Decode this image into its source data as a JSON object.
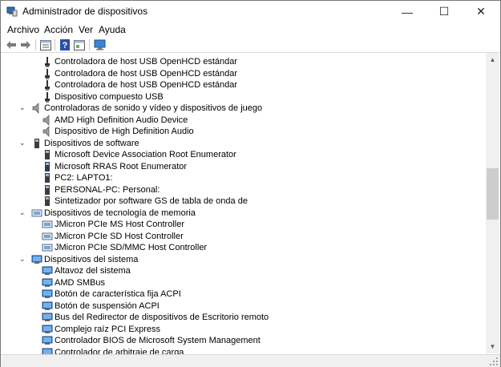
{
  "window": {
    "title": "Administrador de dispositivos",
    "minimize_glyph": "—",
    "maximize_glyph": "☐",
    "close_glyph": "✕"
  },
  "menu": [
    "Archivo",
    "Acción",
    "Ver",
    "Ayuda"
  ],
  "toolbar": {
    "icons": [
      "back-arrow-icon",
      "forward-arrow-icon",
      "properties-icon",
      "help-icon",
      "show-hidden-icon",
      "monitor-icon"
    ]
  },
  "tree": [
    {
      "label": "Controladora de host USB OpenHCD estándar",
      "level": 2,
      "icon": "usb"
    },
    {
      "label": "Controladora de host USB OpenHCD estándar",
      "level": 2,
      "icon": "usb"
    },
    {
      "label": "Controladora de host USB OpenHCD estándar",
      "level": 2,
      "icon": "usb"
    },
    {
      "label": "Dispositivo compuesto USB",
      "level": 2,
      "icon": "usb"
    },
    {
      "label": "Controladoras de sonido y vídeo y dispositivos de juego",
      "level": 1,
      "icon": "speaker",
      "expander": "⌄"
    },
    {
      "label": "AMD High Definition Audio Device",
      "level": 2,
      "icon": "speaker"
    },
    {
      "label": "Dispositivo de High Definition Audio",
      "level": 2,
      "icon": "speaker"
    },
    {
      "label": "Dispositivos de software",
      "level": 1,
      "icon": "device",
      "expander": "⌄"
    },
    {
      "label": "Microsoft Device Association Root Enumerator",
      "level": 2,
      "icon": "device"
    },
    {
      "label": "Microsoft RRAS Root Enumerator",
      "level": 2,
      "icon": "device"
    },
    {
      "label": "PC2: LAPTO1:",
      "level": 2,
      "icon": "device"
    },
    {
      "label": "PERSONAL-PC: Personal:",
      "level": 2,
      "icon": "device"
    },
    {
      "label": "Sintetizador por software GS de tabla de onda de",
      "level": 2,
      "icon": "device"
    },
    {
      "label": "Dispositivos de tecnología de memoria",
      "level": 1,
      "icon": "memory",
      "expander": "⌄"
    },
    {
      "label": "JMicron PCIe MS Host Controller",
      "level": 2,
      "icon": "memory"
    },
    {
      "label": "JMicron PCIe SD Host Controller",
      "level": 2,
      "icon": "memory"
    },
    {
      "label": "JMicron PCIe SD/MMC Host Controller",
      "level": 2,
      "icon": "memory"
    },
    {
      "label": "Dispositivos del sistema",
      "level": 1,
      "icon": "system",
      "expander": "⌄"
    },
    {
      "label": "Altavoz del sistema",
      "level": 2,
      "icon": "system"
    },
    {
      "label": "AMD SMBus",
      "level": 2,
      "icon": "system"
    },
    {
      "label": "Botón de característica fija ACPI",
      "level": 2,
      "icon": "system"
    },
    {
      "label": "Botón de suspensión ACPI",
      "level": 2,
      "icon": "system"
    },
    {
      "label": "Bus del Redirector de dispositivos de Escritorio remoto",
      "level": 2,
      "icon": "system"
    },
    {
      "label": "Complejo raíz PCI Express",
      "level": 2,
      "icon": "system"
    },
    {
      "label": "Controlador BIOS de Microsoft System Management",
      "level": 2,
      "icon": "system"
    },
    {
      "label": "Controlador de arbitraje de carga",
      "level": 2,
      "icon": "system"
    }
  ],
  "scrollbar": {
    "up_glyph": "▲",
    "down_glyph": "▼"
  },
  "colors": {
    "accent": "#1f5fbf",
    "tree_line": "#808080"
  }
}
